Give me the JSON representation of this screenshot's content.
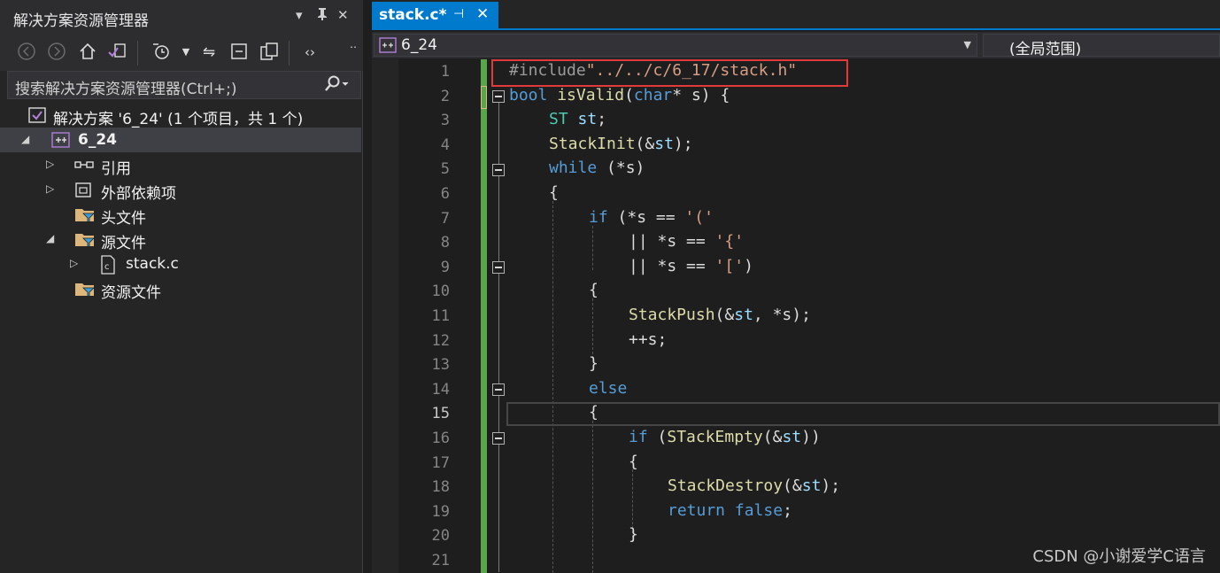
{
  "solution_explorer": {
    "title": "解决方案资源管理器",
    "title_controls": [
      "▾",
      "⊥",
      "✕"
    ],
    "search_placeholder": "搜索解决方案资源管理器(Ctrl+;)",
    "toolbar_icons": [
      "back-icon",
      "forward-icon",
      "home-icon",
      "vs-switch-views-icon",
      "pending-changes-filter-icon",
      "sync-icon",
      "collapse-all-icon",
      "show-all-files-icon",
      "code-view-icon"
    ],
    "tree": {
      "solution": "解决方案 '6_24' (1 个项目，共 1 个)",
      "project": "6_24",
      "references": "引用",
      "external_deps": "外部依赖项",
      "header_files": "头文件",
      "source_files": "源文件",
      "stack_c": "stack.c",
      "resource_files": "资源文件"
    }
  },
  "editor": {
    "tab": {
      "name": "stack.c*",
      "pin": "⊣",
      "close": "✕"
    },
    "nav": {
      "left": "6_24",
      "right": "(全局范围)"
    },
    "current_line": 15,
    "line_numbers": [
      "1",
      "2",
      "3",
      "4",
      "5",
      "6",
      "7",
      "8",
      "9",
      "10",
      "11",
      "12",
      "13",
      "14",
      "15",
      "16",
      "17",
      "18",
      "19",
      "20",
      "21"
    ],
    "code": {
      "l1": {
        "pp": "#include",
        "str": "\"../../c/6_17/stack.h\""
      },
      "l2": {
        "kw": "bool",
        "fn": "isValid",
        "open": "(",
        "kw2": "char",
        "rest": "* s) {"
      },
      "l3": {
        "ty": "ST",
        "id": "st",
        "rest": ";"
      },
      "l4": {
        "fn": "StackInit",
        "a": "(&",
        "id": "st",
        "b": ");"
      },
      "l5": {
        "kw": "while",
        "rest": " (*s)"
      },
      "l6": "{",
      "l7": {
        "kw": "if",
        "a": " (*s == ",
        "st": "'('"
      },
      "l8": {
        "a": "|| *s == ",
        "st": "'{'"
      },
      "l9": {
        "a": "|| *s == ",
        "st": "'['",
        "b": ")"
      },
      "l10": "{",
      "l11": {
        "fn": "StackPush",
        "a": "(&",
        "id": "st",
        "b": ", *s);"
      },
      "l12": "++s;",
      "l13": "}",
      "l14": {
        "kw": "else"
      },
      "l15": "{",
      "l16": {
        "kw": "if",
        "a": " (",
        "fn": "STackEmpty",
        "b": "(&",
        "id": "st",
        "c": "))"
      },
      "l17": "{",
      "l18": {
        "fn": "StackDestroy",
        "a": "(&",
        "id": "st",
        "b": ");"
      },
      "l19": {
        "kw": "return",
        "kw2": "false",
        "b": ";"
      },
      "l20": "}"
    }
  },
  "watermark": "CSDN @小谢爱学C语言",
  "colors": {
    "accent": "#007acc",
    "change_bar": "#57a64a",
    "highlight_box": "#e03a3a"
  }
}
